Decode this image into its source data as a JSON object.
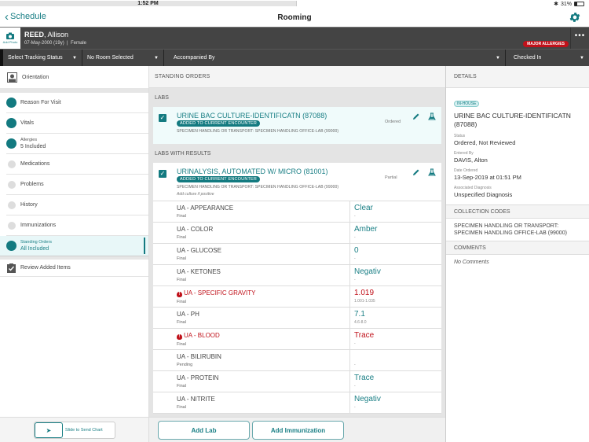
{
  "status_bar": {
    "device": "iPad",
    "time": "1:52 PM",
    "battery": "31%",
    "battery_level": 0.31
  },
  "nav": {
    "back_label": "Schedule",
    "title": "Rooming"
  },
  "patient": {
    "add_photo_label": "Add Photo",
    "last_name": "REED",
    "first_name": ", Allison",
    "dob_age": "07-May-2000 (19y)",
    "separator": "|",
    "sex": "Female",
    "allergy_badge": "MAJOR ALLERGIES",
    "more_label": "•••"
  },
  "tracking": {
    "status": "Select Tracking Status",
    "room": "No Room Selected",
    "accompanied": "Accompanied By",
    "checkin": "Checked In",
    "caret": "▼"
  },
  "sidebar": {
    "orientation": "Orientation",
    "items": [
      {
        "label": "Reason For Visit",
        "done": true
      },
      {
        "label": "Vitals",
        "done": true
      },
      {
        "small": "Allergies",
        "big": "5 Included",
        "done": true
      },
      {
        "label": "Medications",
        "done": false
      },
      {
        "label": "Problems",
        "done": false
      },
      {
        "label": "History",
        "done": false
      },
      {
        "label": "Immunizations",
        "done": false
      },
      {
        "small": "Standing Orders",
        "big": "All Included",
        "done": true,
        "active": true
      }
    ],
    "review": "Review Added Items",
    "slide_label": "Slide to Send Chart",
    "slide_arrow": "➤"
  },
  "center": {
    "section_title": "STANDING ORDERS",
    "labs_title": "LABS",
    "labs_results_title": "LABS WITH RESULTS",
    "labs": [
      {
        "title": "URINE BAC CULTURE-IDENTIFICATN (87088)",
        "badge": "ADDED TO CURRENT ENCOUNTER",
        "spec": "SPECIMEN HANDLING OR TRANSPORT: SPECIMEN HANDLING OFFICE-LAB (99000)",
        "status": "Ordered"
      }
    ],
    "results_card": {
      "title": "URINALYSIS, AUTOMATED W/ MICRO (81001)",
      "badge": "ADDED TO CURRENT ENCOUNTER",
      "spec": "SPECIMEN HANDLING OR TRANSPORT: SPECIMEN HANDLING OFFICE-LAB (99000)",
      "note": "Add culture if positive",
      "status": "Partial",
      "rows": [
        {
          "name": "UA - APPEARANCE",
          "status": "Final",
          "value": "Clear",
          "range": "-",
          "abnormal": false
        },
        {
          "name": "UA - COLOR",
          "status": "Final",
          "value": "Amber",
          "range": "-",
          "abnormal": false
        },
        {
          "name": "UA - GLUCOSE",
          "status": "Final",
          "value": "0",
          "range": "-",
          "abnormal": false
        },
        {
          "name": "UA - KETONES",
          "status": "Final",
          "value": "Negativ",
          "range": "-",
          "abnormal": false
        },
        {
          "name": "UA - SPECIFIC GRAVITY",
          "status": "Final",
          "value": "1.019",
          "range": "1.001-1.035",
          "abnormal": true
        },
        {
          "name": "UA - PH",
          "status": "Final",
          "value": "7.1",
          "range": "4.6-8.0",
          "abnormal": false
        },
        {
          "name": "UA - BLOOD",
          "status": "Final",
          "value": "Trace",
          "range": "-",
          "abnormal": true
        },
        {
          "name": "UA - BILIRUBIN",
          "status": "Pending",
          "value": "",
          "range": "-",
          "abnormal": false
        },
        {
          "name": "UA - PROTEIN",
          "status": "Final",
          "value": "Trace",
          "range": "-",
          "abnormal": false
        },
        {
          "name": "UA - NITRITE",
          "status": "Final",
          "value": "Negativ",
          "range": "-",
          "abnormal": false
        }
      ]
    },
    "add_lab": "Add Lab",
    "add_immunization": "Add Immunization"
  },
  "details": {
    "header": "DETAILS",
    "tag": "IN-HOUSE",
    "title": "URINE BAC CULTURE-IDENTIFICATN (87088)",
    "fields": [
      {
        "key": "Status",
        "value": "Ordered, Not Reviewed"
      },
      {
        "key": "Entered By",
        "value": "DAVIS, Alton"
      },
      {
        "key": "Date Ordered",
        "value": "13-Sep-2019 at 01:51 PM"
      },
      {
        "key": "Associated Diagnosis",
        "value": "Unspecified Diagnosis"
      }
    ],
    "collection_header": "COLLECTION CODES",
    "collection_text": "SPECIMEN HANDLING OR TRANSPORT: SPECIMEN HANDLING OFFICE-LAB (99000)",
    "comments_header": "COMMENTS",
    "comments_text": "No Comments"
  },
  "colors": {
    "accent": "#137a80",
    "alert": "#c0111a",
    "header_bg": "#444444"
  }
}
